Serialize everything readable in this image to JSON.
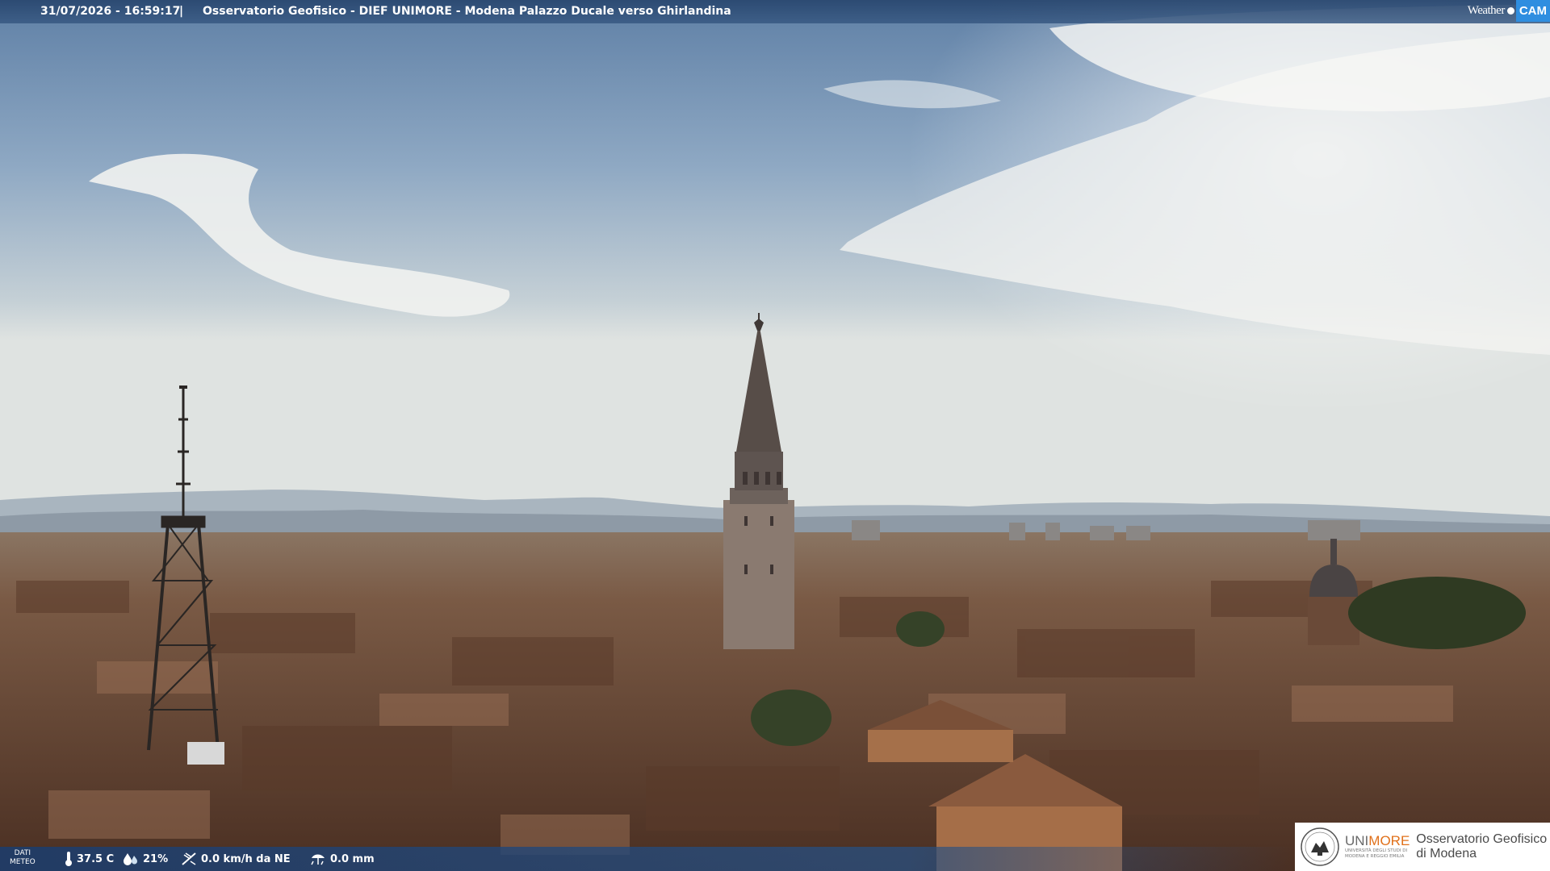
{
  "header": {
    "timestamp": "31/07/2026 - 16:59:17",
    "separator": "|",
    "title": "Osservatorio Geofisico - DIEF UNIMORE - Modena Palazzo Ducale verso Ghirlandina"
  },
  "branding": {
    "weathercam_word": "Weather",
    "weathercam_cam": "CAM"
  },
  "weather": {
    "dati_label": "DATI",
    "meteo_label": "METEO",
    "temperature": "37.5 C",
    "humidity": "21%",
    "wind": "0.0 km/h da NE",
    "rain": "0.0 mm",
    "icons": [
      "thermometer-icon",
      "humidity-icon",
      "wind-icon",
      "rain-icon"
    ]
  },
  "logo": {
    "unimore_a": "UNI",
    "unimore_b": "MORE",
    "university_sub_1": "UNIVERSITÀ DEGLI STUDI DI",
    "university_sub_2": "MODENA E REGGIO EMILIA",
    "observatory_line1": "Osservatorio Geofisico",
    "observatory_line2": "di Modena"
  },
  "colors": {
    "sky_top": "#6f8fb3",
    "sky_horizon": "#d9dfe0",
    "roofs": "#6b4a35",
    "accent_blue": "#2f8ee0",
    "unimore_orange": "#e0701a"
  }
}
